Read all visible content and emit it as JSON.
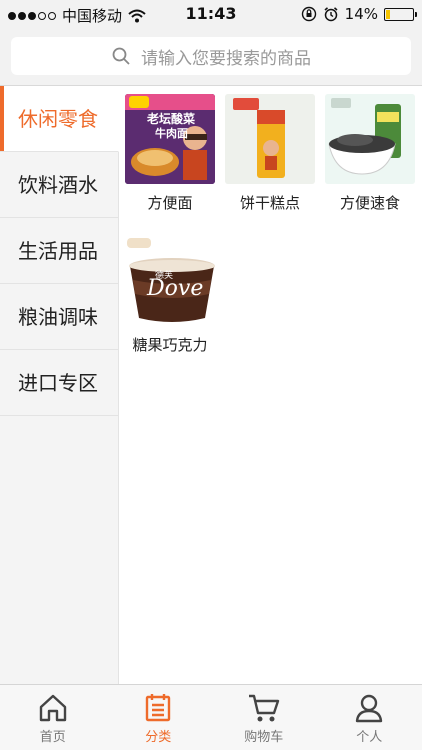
{
  "status_bar": {
    "carrier": "中国移动",
    "time": "11:43",
    "battery_text": "14%",
    "battery_level": 0.14
  },
  "search": {
    "placeholder": "请输入您要搜索的商品"
  },
  "sidebar": {
    "active_index": 0,
    "items": [
      {
        "label": "休闲零食"
      },
      {
        "label": "饮料酒水"
      },
      {
        "label": "生活用品"
      },
      {
        "label": "粮油调味"
      },
      {
        "label": "进口专区"
      }
    ]
  },
  "products": [
    {
      "label": "方便面",
      "thumb_text_1": "老坛酸菜",
      "thumb_text_2": "牛肉面"
    },
    {
      "label": "饼干糕点"
    },
    {
      "label": "方便速食"
    },
    {
      "label": "糖果巧克力",
      "thumb_text_1": "Dove",
      "thumb_text_2": "德芙"
    }
  ],
  "tabbar": {
    "items": [
      {
        "label": "首页",
        "icon": "home-icon"
      },
      {
        "label": "分类",
        "icon": "category-icon"
      },
      {
        "label": "购物车",
        "icon": "cart-icon"
      },
      {
        "label": "个人",
        "icon": "person-icon"
      }
    ],
    "active_index": 1
  },
  "colors": {
    "accent": "#ee6b2b",
    "status_bar_bg": "#f2f2f2",
    "battery": "#f5c400"
  }
}
